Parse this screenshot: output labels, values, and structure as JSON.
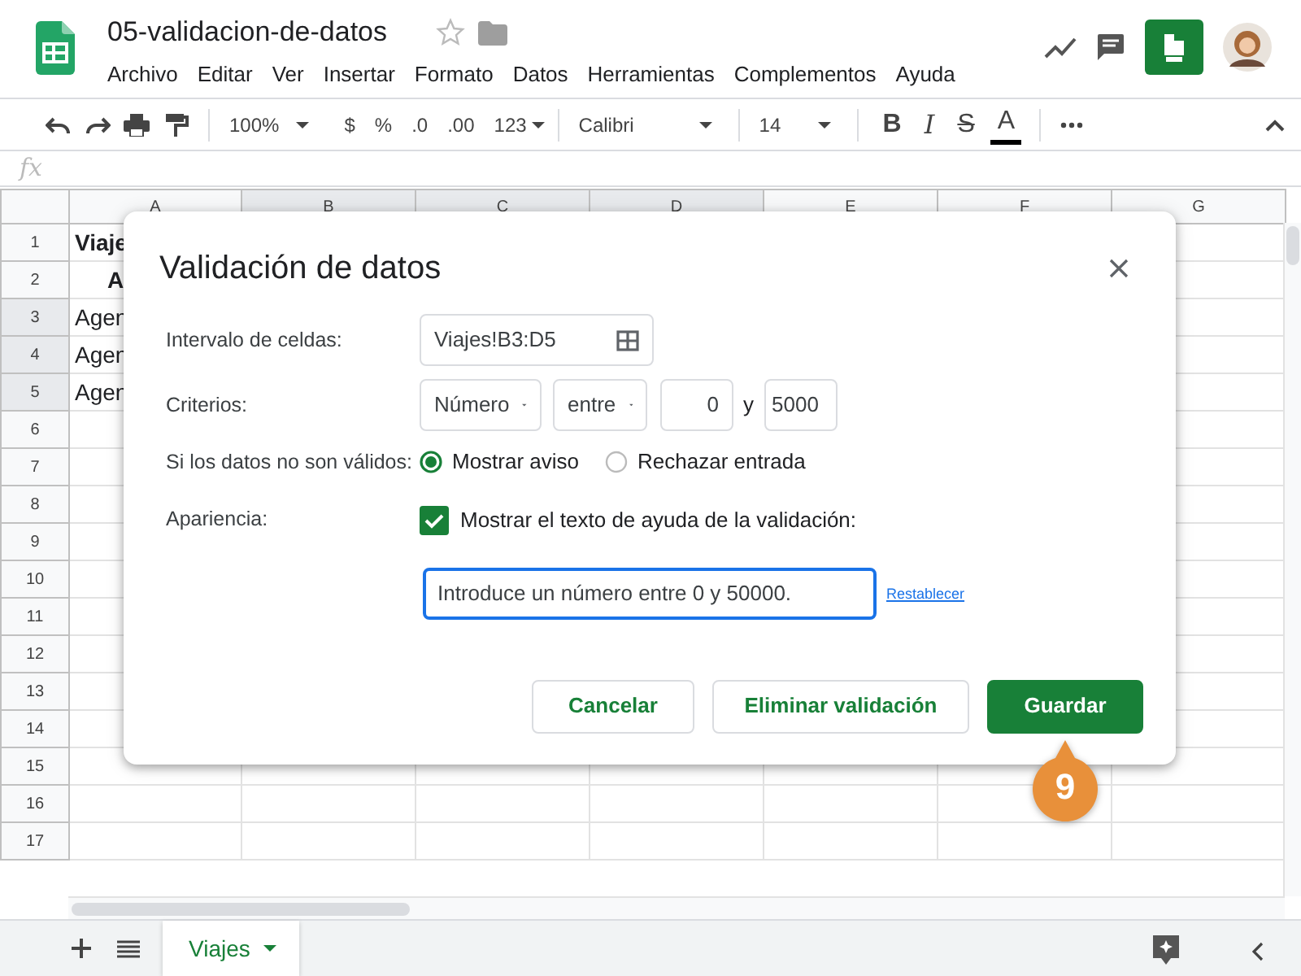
{
  "document": {
    "title": "05-validacion-de-datos"
  },
  "menu": [
    "Archivo",
    "Editar",
    "Ver",
    "Insertar",
    "Formato",
    "Datos",
    "Herramientas",
    "Complementos",
    "Ayuda"
  ],
  "toolbar": {
    "zoom": "100%",
    "number_formats": [
      "$",
      "%",
      ".0",
      ".00",
      "123"
    ],
    "font": "Calibri",
    "font_size": "14",
    "text_styles": [
      "B",
      "I",
      "S",
      "A"
    ]
  },
  "formula_bar": {
    "label": "fx"
  },
  "columns": [
    {
      "label": "A",
      "selected": false
    },
    {
      "label": "B",
      "selected": true
    },
    {
      "label": "C",
      "selected": true
    },
    {
      "label": "D",
      "selected": true
    },
    {
      "label": "E",
      "selected": false
    },
    {
      "label": "F",
      "selected": false
    },
    {
      "label": "G",
      "selected": false
    }
  ],
  "rows": [
    {
      "number": "1",
      "selected": false,
      "cell": "Viaje",
      "kind": "title"
    },
    {
      "number": "2",
      "selected": false,
      "cell": "A",
      "kind": "heading"
    },
    {
      "number": "3",
      "selected": true,
      "cell": "Agen",
      "kind": "plain"
    },
    {
      "number": "4",
      "selected": true,
      "cell": "Agen",
      "kind": "plain"
    },
    {
      "number": "5",
      "selected": true,
      "cell": "Agen",
      "kind": "plain"
    },
    {
      "number": "6",
      "selected": false
    },
    {
      "number": "7",
      "selected": false
    },
    {
      "number": "8",
      "selected": false
    },
    {
      "number": "9",
      "selected": false
    },
    {
      "number": "10",
      "selected": false
    },
    {
      "number": "11",
      "selected": false
    },
    {
      "number": "12",
      "selected": false
    },
    {
      "number": "13",
      "selected": false
    },
    {
      "number": "14",
      "selected": false
    },
    {
      "number": "15",
      "selected": false
    },
    {
      "number": "16",
      "selected": false
    },
    {
      "number": "17",
      "selected": false
    }
  ],
  "dialog": {
    "title": "Validación de datos",
    "range": {
      "label": "Intervalo de celdas:",
      "value": "Viajes!B3:D5"
    },
    "criteria": {
      "label": "Criterios:",
      "type": "Número",
      "condition": "entre",
      "min": "0",
      "joiner": "y",
      "max": "5000"
    },
    "invalid": {
      "label": "Si los datos no son válidos:",
      "options": [
        {
          "label": "Mostrar aviso",
          "selected": true
        },
        {
          "label": "Rechazar entrada",
          "selected": false
        }
      ]
    },
    "appearance": {
      "label": "Apariencia:",
      "checkbox": {
        "label": "Mostrar el texto de ayuda de la validación:",
        "checked": true
      },
      "help_text": "Introduce un número entre 0 y 50000.",
      "reset_link": "Restablecer"
    },
    "buttons": [
      {
        "label": "Cancelar",
        "kind": "secondary"
      },
      {
        "label": "Eliminar validación",
        "kind": "secondary"
      },
      {
        "label": "Guardar",
        "kind": "primary"
      }
    ]
  },
  "callout": {
    "label": "9"
  },
  "sheet_tabs": [
    {
      "label": "Viajes",
      "selected": true
    }
  ]
}
